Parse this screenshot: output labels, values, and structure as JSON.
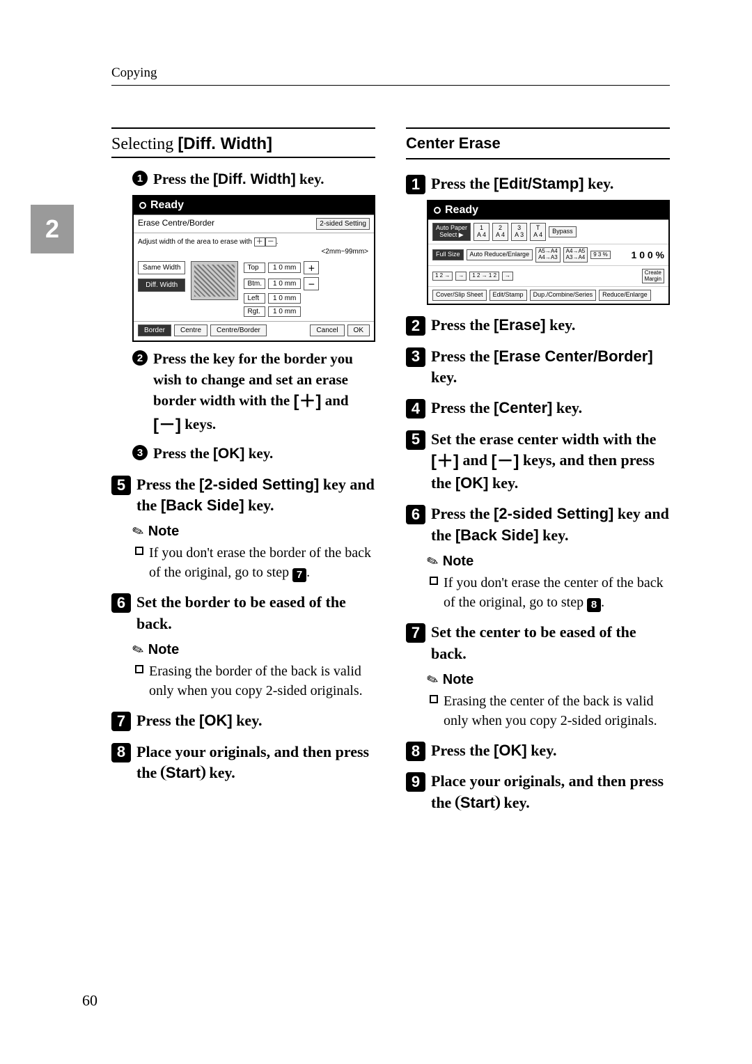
{
  "running_head": "Copying",
  "page_number": "60",
  "side_tab": "2",
  "left": {
    "section_title_pre": "Selecting ",
    "section_title_bracket": "[Diff. Width]",
    "sub1": {
      "num": "1",
      "pre": "Press the ",
      "ui": "[Diff. Width]",
      "post": " key."
    },
    "erase_panel": {
      "ready": "Ready",
      "title": "Erase Centre/Border",
      "two_sided": "2-sided Setting",
      "adjust": "Adjust width of the area to erase with ",
      "range": "<2mm~99mm>",
      "same_width": "Same Width",
      "diff_width": "Diff. Width",
      "top": "Top",
      "btm": "Btm.",
      "left": "Left",
      "rgt": "Rgt.",
      "val": "1 0 mm",
      "border": "Border",
      "centre": "Centre",
      "centre_border": "Centre/Border",
      "cancel": "Cancel",
      "ok": "OK"
    },
    "sub2": {
      "num": "2",
      "line1": "Press the key for the border you wish to change and set an erase border width with the ",
      "plus": "[＋]",
      "and": " and ",
      "minus": "[－]",
      "post": " keys."
    },
    "sub3": {
      "num": "3",
      "pre": "Press the ",
      "ui": "[OK]",
      "post": " key."
    },
    "step5": {
      "num": "5",
      "pre": "Press the ",
      "ui1": "[2-sided Setting]",
      "mid": " key and the ",
      "ui2": "[Back Side]",
      "post": " key."
    },
    "note": "Note",
    "note5_text_a": "If you don't erase the border of the back of the original, go to step ",
    "note5_ref": "7",
    "step6": {
      "num": "6",
      "text": "Set the border to be eased of the back."
    },
    "note6_text": "Erasing the border of the back is valid only when you copy 2-sided originals.",
    "step7": {
      "num": "7",
      "pre": "Press the ",
      "ui": "[OK]",
      "post": " key."
    },
    "step8": {
      "num": "8",
      "pre": "Place your originals, and then press the ",
      "key": "Start",
      "post": " key."
    }
  },
  "right": {
    "title": "Center Erase",
    "step1": {
      "num": "1",
      "pre": "Press the ",
      "ui": "[Edit/Stamp]",
      "post": " key."
    },
    "ready_panel": {
      "ready": "Ready",
      "auto_paper": "Auto Paper\nSelect ▶",
      "trays": [
        "A 4",
        "A 4",
        "A 3",
        "A 4"
      ],
      "tray_top": [
        "1",
        "2",
        "3",
        "T"
      ],
      "bypass": "Bypass",
      "full_size": "Full Size",
      "auto_re": "Auto Reduce/Enlarge",
      "r1": "A5→A4\nA4→A3",
      "r2": "A4→A5\nA3→A4",
      "pct_small": "9 3 %",
      "pct_big": "1 0 0 %",
      "create_margin": "Create\nMargin",
      "row4": [
        "Cover/Slip Sheet",
        "Edit/Stamp",
        "Dup./Combine/Series",
        "Reduce/Enlarge"
      ]
    },
    "step2": {
      "num": "2",
      "pre": "Press the ",
      "ui": "[Erase]",
      "post": " key."
    },
    "step3": {
      "num": "3",
      "pre": "Press the ",
      "ui": "[Erase Center/Border]",
      "post": " key."
    },
    "step4": {
      "num": "4",
      "pre": "Press the ",
      "ui": "[Center]",
      "post": " key."
    },
    "step5": {
      "num": "5",
      "pre": "Set the erase center width with the ",
      "plus": "[＋]",
      "and": " and ",
      "minus": "[－]",
      "mid": " keys, and then press the ",
      "ui": "[OK]",
      "post": " key."
    },
    "step6": {
      "num": "6",
      "pre": "Press the ",
      "ui1": "[2-sided Setting]",
      "mid": " key and the ",
      "ui2": "[Back Side]",
      "post": " key."
    },
    "note": "Note",
    "note6_text_a": "If you don't erase the center of the back of the original, go to step ",
    "note6_ref": "8",
    "step7": {
      "num": "7",
      "text": "Set the center to be eased of the back."
    },
    "note7_text": "Erasing the center of the back is valid only when you copy 2-sided originals.",
    "step8": {
      "num": "8",
      "pre": "Press the ",
      "ui": "[OK]",
      "post": " key."
    },
    "step9": {
      "num": "9",
      "pre": "Place your originals, and then press the ",
      "key": "Start",
      "post": " key."
    }
  }
}
